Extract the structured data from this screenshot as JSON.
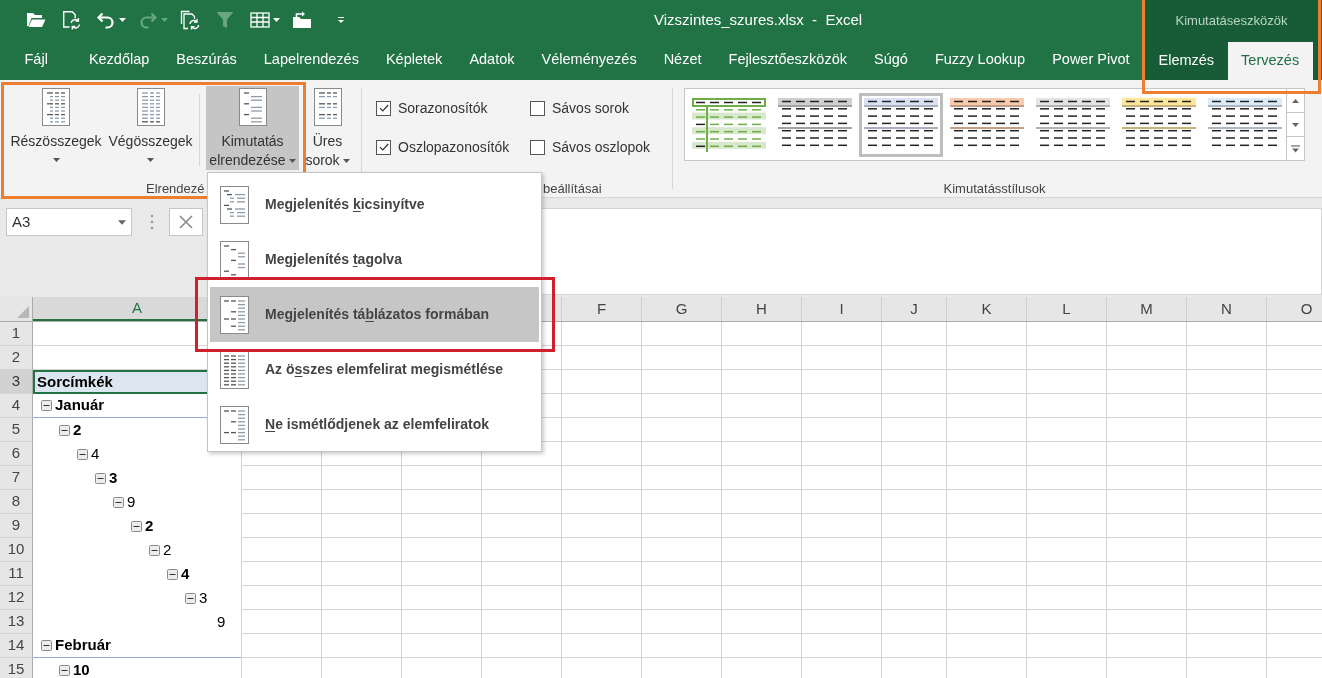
{
  "window": {
    "title": "Vizszintes_szures.xlsx  -  Excel"
  },
  "quick_access_toolbar": {
    "buttons": [
      {
        "disabled": false,
        "dropdown": false
      },
      {
        "disabled": false,
        "dropdown": false
      },
      {
        "disabled": false,
        "dropdown": true
      },
      {
        "disabled": true,
        "dropdown": true
      },
      {
        "disabled": false,
        "dropdown": false
      },
      {
        "disabled": true,
        "dropdown": false
      },
      {
        "disabled": false,
        "dropdown": true
      },
      {
        "disabled": false,
        "dropdown": false
      }
    ]
  },
  "ribbon_tabs": [
    {
      "label": "Fájl",
      "selected": false
    },
    {
      "label": "Kezdőlap",
      "selected": false
    },
    {
      "label": "Beszúrás",
      "selected": false
    },
    {
      "label": "Lapelrendezés",
      "selected": false
    },
    {
      "label": "Képletek",
      "selected": false
    },
    {
      "label": "Adatok",
      "selected": false
    },
    {
      "label": "Véleményezés",
      "selected": false
    },
    {
      "label": "Nézet",
      "selected": false
    },
    {
      "label": "Fejlesztőeszközök",
      "selected": false
    },
    {
      "label": "Súgó",
      "selected": false
    },
    {
      "label": "Fuzzy Lookup",
      "selected": false
    },
    {
      "label": "Power Pivot",
      "selected": false
    }
  ],
  "contextual_tabs": {
    "title": "Kimutatáseszközök",
    "tabs": [
      {
        "label": "Elemzés",
        "selected": false
      },
      {
        "label": "Tervezés",
        "selected": true
      }
    ]
  },
  "ribbon": {
    "layout_group": {
      "label": "Elrendezé",
      "buttons": [
        {
          "label_lines": [
            "Részösszegek"
          ],
          "expanded": false
        },
        {
          "label_lines": [
            "Végösszegek"
          ],
          "expanded": false
        },
        {
          "label_lines": [
            "Kimutatás",
            "elrendezése"
          ],
          "expanded": true
        },
        {
          "label_lines": [
            "Üres",
            "sorok"
          ],
          "expanded": false
        }
      ]
    },
    "options_group": {
      "label": "beállításai",
      "checkboxes": [
        {
          "label": "Sorazonosítók",
          "checked": true
        },
        {
          "label": "Oszlopazonosítók",
          "checked": true
        },
        {
          "label": "Sávos sorok",
          "checked": false
        },
        {
          "label": "Sávos oszlopok",
          "checked": false
        }
      ]
    },
    "styles_group": {
      "label": "Kimutatásstílusok",
      "styles": [
        {
          "kind": "banded",
          "color": "#70ad47",
          "selected": false
        },
        {
          "kind": "header",
          "color": "#d0d0d0",
          "selected": false
        },
        {
          "kind": "header",
          "color": "#d9e1f2",
          "selected": true
        },
        {
          "kind": "header",
          "color": "#f8cbad",
          "selected": false
        },
        {
          "kind": "header",
          "color": "#e4e4e4",
          "selected": false
        },
        {
          "kind": "header",
          "color": "#ffe699",
          "selected": false
        },
        {
          "kind": "header",
          "color": "#ddebf7",
          "selected": false
        }
      ]
    }
  },
  "layout_menu": {
    "items": [
      {
        "text_before": "Megjelenítés ",
        "access_key": "k",
        "text_after": "icsinyítve",
        "selected": false
      },
      {
        "text_before": "Megjelenítés ",
        "access_key": "t",
        "text_after": "agolva",
        "selected": false
      },
      {
        "text_before": "Megjelenítés tá",
        "access_key": "b",
        "text_after": "lázatos formában",
        "selected": true
      },
      {
        "text_before": "Az ö",
        "access_key": "s",
        "text_after": "szes elemfelirat megismétlése",
        "selected": false
      },
      {
        "access_key": "N",
        "text_after": "e ismétlődjenek az elemfeliratok",
        "selected": false
      }
    ]
  },
  "formula_bar": {
    "name_box": "A3"
  },
  "sheet": {
    "columns": [
      {
        "label": "A",
        "selected": true
      },
      {
        "label": "F",
        "selected": false
      },
      {
        "label": "G",
        "selected": false
      },
      {
        "label": "H",
        "selected": false
      },
      {
        "label": "I",
        "selected": false
      },
      {
        "label": "J",
        "selected": false
      },
      {
        "label": "K",
        "selected": false
      },
      {
        "label": "L",
        "selected": false
      },
      {
        "label": "M",
        "selected": false
      },
      {
        "label": "N",
        "selected": false
      },
      {
        "label": "O",
        "selected": false
      }
    ],
    "rows": [
      {
        "label": "1",
        "selected": false
      },
      {
        "label": "2",
        "selected": false
      },
      {
        "label": "3",
        "selected": true
      },
      {
        "label": "4",
        "selected": false
      },
      {
        "label": "5",
        "selected": false
      },
      {
        "label": "6",
        "selected": false
      },
      {
        "label": "7",
        "selected": false
      },
      {
        "label": "8",
        "selected": false
      },
      {
        "label": "9",
        "selected": false
      },
      {
        "label": "10",
        "selected": false
      },
      {
        "label": "11",
        "selected": false
      },
      {
        "label": "12",
        "selected": false
      },
      {
        "label": "13",
        "selected": false
      },
      {
        "label": "14",
        "selected": false
      },
      {
        "label": "15",
        "selected": false
      }
    ],
    "pivot": {
      "header": "Sorcímkék",
      "rows": [
        {
          "label": "Január",
          "bold": true,
          "kind": "group",
          "expanded": true,
          "children": [
            {
              "label": "2",
              "bold": true,
              "kind": "group",
              "expanded": true,
              "children": [
                {
                  "label": "4",
                  "bold": false,
                  "kind": "group",
                  "expanded": true,
                  "children": [
                    {
                      "label": "3",
                      "bold": true,
                      "kind": "group",
                      "expanded": true,
                      "children": [
                        {
                          "label": "9",
                          "bold": false,
                          "kind": "group",
                          "expanded": true,
                          "children": [
                            {
                              "label": "2",
                              "bold": true,
                              "kind": "group",
                              "expanded": true,
                              "children": [
                                {
                                  "label": "2",
                                  "bold": false,
                                  "kind": "group",
                                  "expanded": true,
                                  "children": [
                                    {
                                      "label": "4",
                                      "bold": true,
                                      "kind": "group",
                                      "expanded": true,
                                      "children": [
                                        {
                                          "label": "3",
                                          "bold": false,
                                          "kind": "group",
                                          "expanded": true,
                                          "children": [
                                            {
                                              "label": "9",
                                              "bold": false,
                                              "kind": "value"
                                            }
                                          ]
                                        }
                                      ]
                                    }
                                  ]
                                }
                              ]
                            }
                          ]
                        }
                      ]
                    }
                  ]
                }
              ]
            }
          ]
        },
        {
          "label": "Február",
          "bold": true,
          "kind": "group",
          "expanded": true,
          "children": [
            {
              "label": "10",
              "bold": true,
              "kind": "group",
              "expanded": true
            }
          ]
        }
      ]
    }
  },
  "highlights": [
    {
      "color": "#ed7d31"
    },
    {
      "color": "#ed7d31"
    },
    {
      "color": "#d0202e"
    }
  ]
}
